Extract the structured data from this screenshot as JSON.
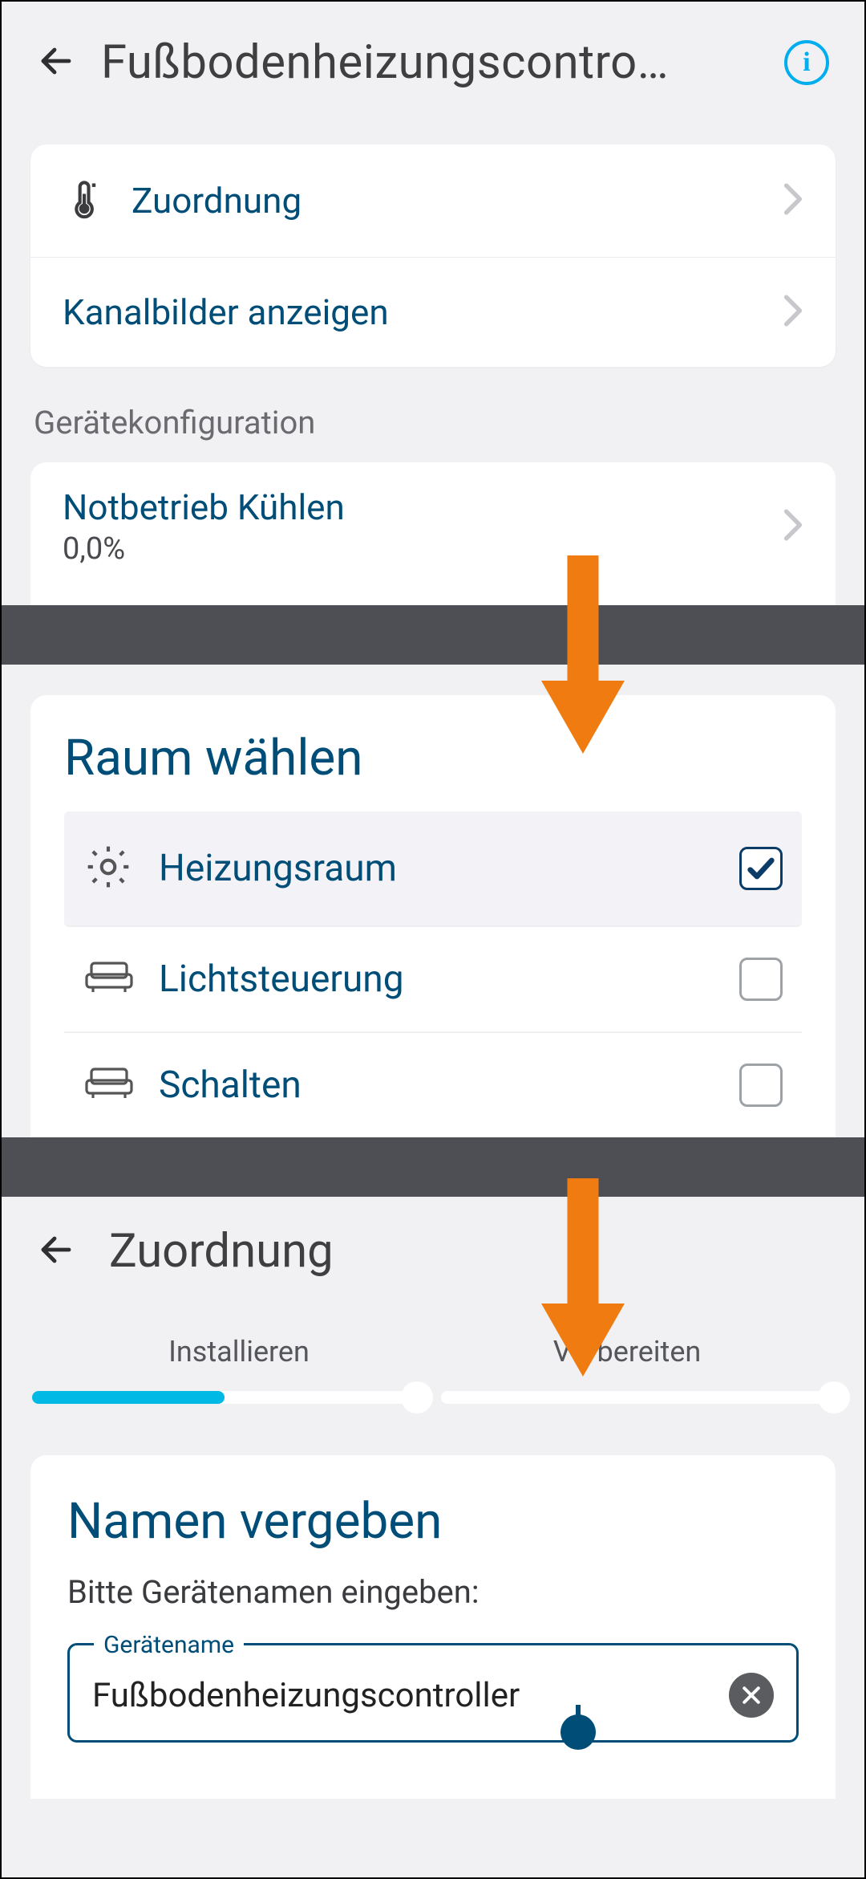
{
  "panel1": {
    "title": "Fußbodenheizungscontro…",
    "rows": {
      "zuordnung": "Zuordnung",
      "kanalbilder": "Kanalbilder anzeigen"
    },
    "section_label": "Gerätekonfiguration",
    "notbetrieb": {
      "title": "Notbetrieb Kühlen",
      "value": "0,0%"
    }
  },
  "panel2": {
    "heading": "Raum wählen",
    "rooms": [
      {
        "label": "Heizungsraum",
        "checked": true,
        "icon": "gear"
      },
      {
        "label": "Lichtsteuerung",
        "checked": false,
        "icon": "sofa"
      },
      {
        "label": "Schalten",
        "checked": false,
        "icon": "sofa"
      }
    ]
  },
  "panel3": {
    "title": "Zuordnung",
    "steps": {
      "step1": "Installieren",
      "step2": "Vorbereiten"
    },
    "heading": "Namen vergeben",
    "prompt": "Bitte Gerätenamen eingeben:",
    "field_legend": "Gerätename",
    "field_value": "Fußbodenheizungscontroller"
  }
}
